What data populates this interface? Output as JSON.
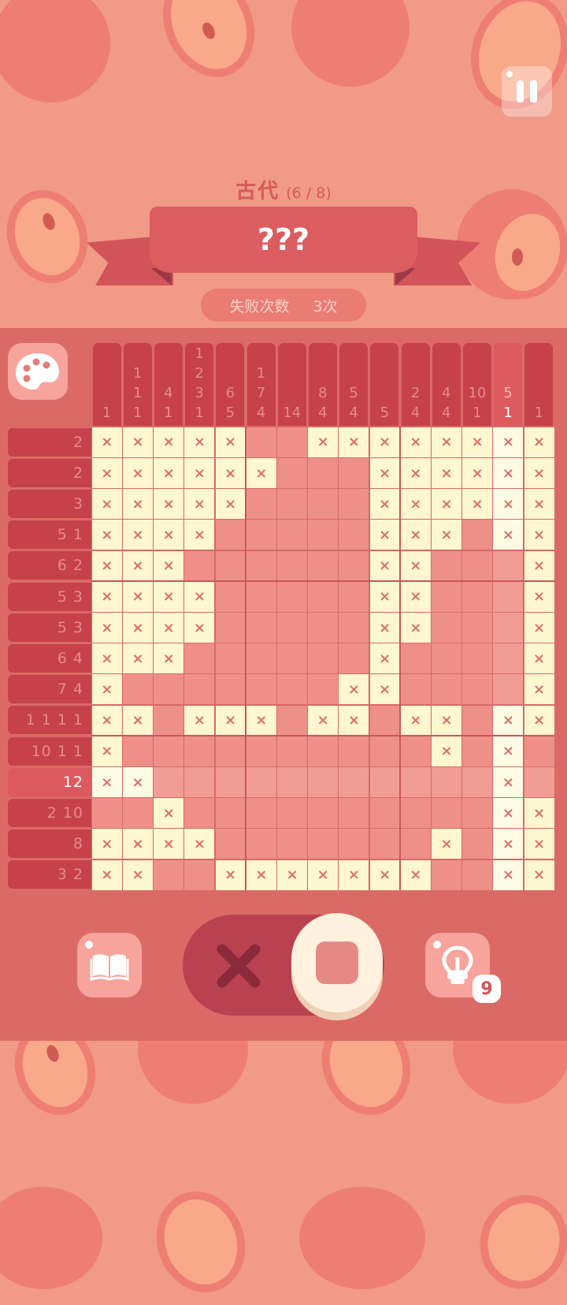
{
  "header": {
    "era": "古代",
    "progress": "(6 / 8)",
    "title": "???",
    "fail_label": "失败次数",
    "fail_count": "3次"
  },
  "controls": {
    "pause_icon": "pause-icon",
    "palette_icon": "palette-icon",
    "book_icon": "book-icon",
    "mode_x_icon": "cross-mark-icon",
    "mode_fill_icon": "filled-square-icon",
    "hint_icon": "lightbulb-icon",
    "hint_count": "9",
    "selected_mode": "fill"
  },
  "puzzle": {
    "size": 15,
    "highlight_row": 11,
    "highlight_col": 13,
    "col_clues": [
      [
        "1"
      ],
      [
        "1",
        "1",
        "1"
      ],
      [
        "4",
        "1"
      ],
      [
        "1",
        "2",
        "3",
        "1"
      ],
      [
        "6",
        "5"
      ],
      [
        "1",
        "7",
        "4"
      ],
      [
        "14"
      ],
      [
        "8",
        "4"
      ],
      [
        "5",
        "4"
      ],
      [
        "5"
      ],
      [
        "2",
        "4"
      ],
      [
        "4",
        "4"
      ],
      [
        "10",
        "1"
      ],
      [
        "5",
        "1"
      ],
      [
        "1"
      ]
    ],
    "row_clues": [
      "2",
      "2",
      "3",
      "5 1",
      "6 2",
      "5 3",
      "5 3",
      "6 4",
      "7 4",
      "1 1 1 1",
      "10 1 1",
      "12",
      "2 10",
      "8",
      "3 2"
    ],
    "cells": [
      "xxxxx..xxxxxxxx",
      "xxxxxx...xxxxxx",
      "xxxxx....xxxxxx",
      "xxxx.....xxx.xx",
      "xxx......xx...x",
      "xxxx.....xx...x",
      "xxxx.....xx...x",
      "xxx......x....x",
      "x.......xx....x",
      "xx.xxx.xx.xx.xx",
      "x..........x.x.",
      "xx...........x.",
      "..x..........xx",
      "xxxx.......x.xx",
      "xx..xxxxxxx..xx"
    ]
  },
  "colors": {
    "background": "#f19a85",
    "accent": "#d2545a",
    "clue_bg": "#c6414a",
    "x_cell": "#fef7cf",
    "empty_cell": "#ee9088"
  }
}
